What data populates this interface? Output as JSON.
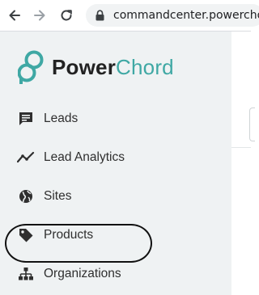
{
  "browser": {
    "url": "commandcenter.powercho",
    "icons": [
      "back-arrow-icon",
      "forward-arrow-icon",
      "reload-icon",
      "lock-icon"
    ]
  },
  "brand": {
    "name_part1": "Power",
    "name_part2": "Chord",
    "accent_color": "#3fa8a4",
    "text_color": "#222222"
  },
  "sidebar": {
    "items": [
      {
        "label": "Leads",
        "icon": "message-icon"
      },
      {
        "label": "Lead Analytics",
        "icon": "line-chart-icon"
      },
      {
        "label": "Sites",
        "icon": "globe-icon"
      },
      {
        "label": "Products",
        "icon": "tag-icon"
      },
      {
        "label": "Organizations",
        "icon": "org-chart-icon"
      }
    ]
  },
  "annotation": {
    "highlighted_item": "Organizations"
  }
}
